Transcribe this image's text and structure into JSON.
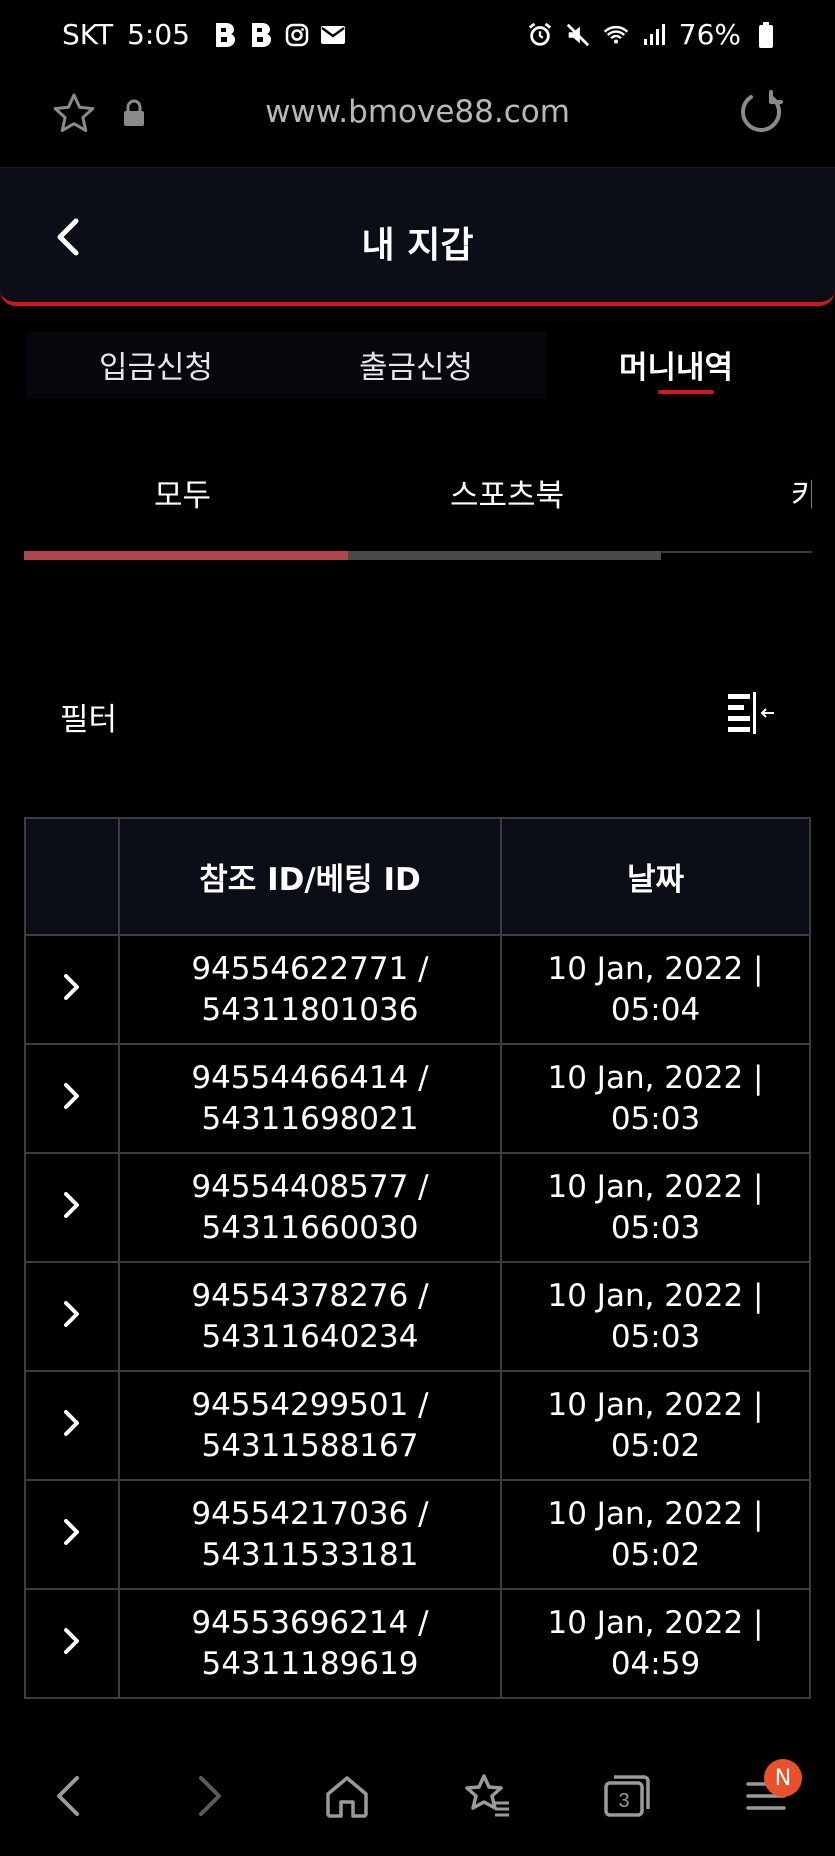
{
  "status_bar": {
    "carrier": "SKT",
    "time": "5:05",
    "battery": "76%",
    "left_icons": [
      "b-app-icon",
      "b-app-icon",
      "instagram-icon",
      "mail-icon"
    ],
    "right_icons": [
      "alarm-icon",
      "mute-icon",
      "wifi-icon",
      "signal-icon",
      "battery-icon"
    ]
  },
  "browser": {
    "url": "www.bmove88.com"
  },
  "header": {
    "title": "내 지갑"
  },
  "main_tabs": [
    {
      "label": "입금신청",
      "active": false
    },
    {
      "label": "출금신청",
      "active": false
    },
    {
      "label": "머니내역",
      "active": true
    }
  ],
  "sub_tabs": [
    {
      "label": "모두",
      "active": true
    },
    {
      "label": "스포츠북",
      "active": false
    },
    {
      "label": "카",
      "active": false
    }
  ],
  "filter": {
    "label": "필터"
  },
  "table": {
    "headers": [
      "",
      "참조 ID/베팅 ID",
      "날짜"
    ],
    "rows": [
      {
        "ref_line1": "94554622771 /",
        "ref_line2": "54311801036",
        "date_line1": "10 Jan, 2022 |",
        "date_line2": "05:04"
      },
      {
        "ref_line1": "94554466414 /",
        "ref_line2": "54311698021",
        "date_line1": "10 Jan, 2022 |",
        "date_line2": "05:03"
      },
      {
        "ref_line1": "94554408577 /",
        "ref_line2": "54311660030",
        "date_line1": "10 Jan, 2022 |",
        "date_line2": "05:03"
      },
      {
        "ref_line1": "94554378276 /",
        "ref_line2": "54311640234",
        "date_line1": "10 Jan, 2022 |",
        "date_line2": "05:03"
      },
      {
        "ref_line1": "94554299501 /",
        "ref_line2": "54311588167",
        "date_line1": "10 Jan, 2022 |",
        "date_line2": "05:02"
      },
      {
        "ref_line1": "94554217036 /",
        "ref_line2": "54311533181",
        "date_line1": "10 Jan, 2022 |",
        "date_line2": "05:02"
      },
      {
        "ref_line1": "94553696214 /",
        "ref_line2": "54311189619",
        "date_line1": "10 Jan, 2022 |",
        "date_line2": "04:59"
      }
    ]
  },
  "bottom_nav": {
    "tab_count": "3",
    "badge": "N",
    "icons": [
      "back-icon",
      "forward-icon",
      "home-icon",
      "bookmarks-icon",
      "tabs-icon",
      "menu-icon"
    ]
  },
  "colors": {
    "accent": "#d5141e",
    "header_bg": "#0b0e16",
    "badge": "#e8512b"
  }
}
